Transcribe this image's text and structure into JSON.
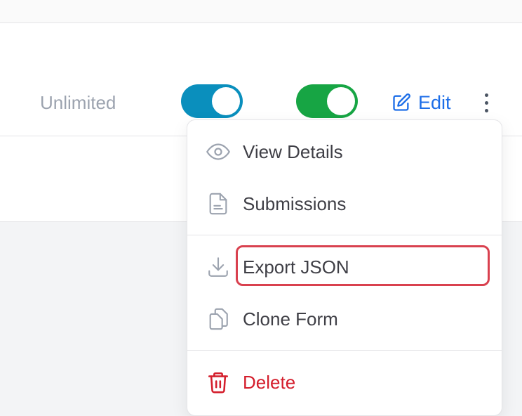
{
  "row": {
    "quota_label": "Unlimited",
    "toggle_1": {
      "state": "on",
      "color": "#0a8fbd"
    },
    "toggle_2": {
      "state": "on",
      "color": "#17a544"
    },
    "edit_label": "Edit",
    "edit_icon": "pencil-square-icon",
    "more_icon": "kebab-vertical-icon"
  },
  "menu": {
    "items": [
      {
        "label": "View Details",
        "icon": "eye-icon"
      },
      {
        "label": "Submissions",
        "icon": "document-icon"
      },
      {
        "label": "Export JSON",
        "icon": "download-icon",
        "highlighted": true
      },
      {
        "label": "Clone Form",
        "icon": "copy-icon"
      },
      {
        "label": "Delete",
        "icon": "trash-icon",
        "color": "#d41e2c"
      }
    ]
  },
  "colors": {
    "accent": "#1d6ee8",
    "highlight_outline": "#d9414f",
    "danger": "#d41e2c"
  }
}
